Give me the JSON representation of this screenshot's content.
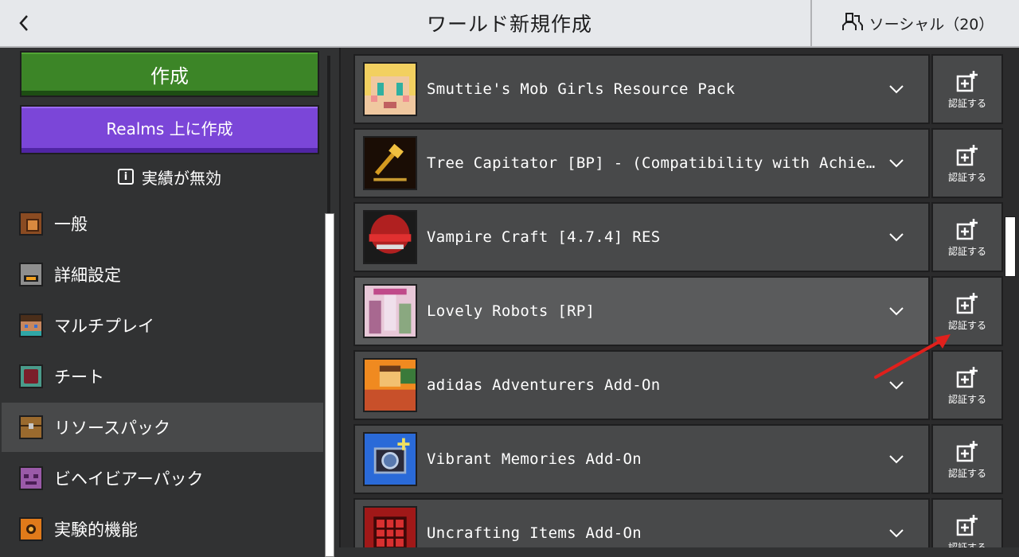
{
  "header": {
    "back_icon": "chevron-left-icon",
    "title": "ワールド新規作成",
    "social_label": "ソーシャル（20）",
    "social_icon": "friends-icon"
  },
  "left_panel": {
    "create_label": "作成",
    "realms_label": "Realms 上に作成",
    "achievements_label": "実績が無効",
    "nav_items": [
      {
        "label": "一般",
        "icon": "gear-icon"
      },
      {
        "label": "詳細設定",
        "icon": "furnace-icon"
      },
      {
        "label": "マルチプレイ",
        "icon": "player-head-icon"
      },
      {
        "label": "チート",
        "icon": "command-block-icon"
      },
      {
        "label": "リソースパック",
        "icon": "chest-icon",
        "selected": true
      },
      {
        "label": "ビヘイビアーパック",
        "icon": "mob-face-icon"
      },
      {
        "label": "実験的機能",
        "icon": "experimental-icon"
      }
    ]
  },
  "packs": [
    {
      "name": "Smuttie's Mob Girls Resource Pack",
      "auth_label": "認証する"
    },
    {
      "name": "Tree Capitator [BP] - (Compatibility with Achieveme…",
      "auth_label": "認証する"
    },
    {
      "name": "Vampire Craft [4.7.4] RES",
      "auth_label": "認証する"
    },
    {
      "name": "Lovely Robots [RP]",
      "auth_label": "認証する",
      "highlight": true
    },
    {
      "name": "adidas Adventurers Add-On",
      "auth_label": "認証する"
    },
    {
      "name": "Vibrant Memories Add-On",
      "auth_label": "認証する"
    },
    {
      "name": "Uncrafting Items Add-On",
      "auth_label": "認証する"
    }
  ],
  "colors": {
    "create_green": "#3c8527",
    "realms_purple": "#7b46d8",
    "annotation_red": "#e0201c"
  }
}
